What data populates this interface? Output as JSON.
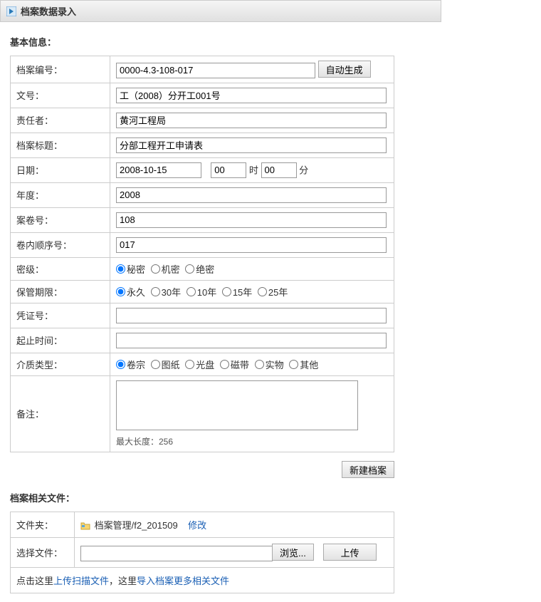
{
  "header": {
    "title": "档案数据录入"
  },
  "sections": {
    "basic_info": "基本信息：",
    "related_files": "档案相关文件："
  },
  "labels": {
    "archive_number": "档案编号：",
    "document_number": "文号：",
    "responsible": "责任者：",
    "archive_title": "档案标题：",
    "date": "日期：",
    "hour_suffix": "时",
    "minute_suffix": "分",
    "year": "年度：",
    "dossier_number": "案卷号：",
    "in_volume_seq": "卷内顺序号：",
    "secret_level": "密级：",
    "retention": "保管期限：",
    "voucher_number": "凭证号：",
    "start_end_time": "起止时间：",
    "media_type": "介质类型：",
    "remark": "备注：",
    "max_length": "最大长度：256"
  },
  "values": {
    "archive_number": "0000-4.3-108-017",
    "document_number": "工（2008）分开工001号",
    "responsible": "黄河工程局",
    "archive_title": "分部工程开工申请表",
    "date": "2008-10-15",
    "hour": "00",
    "minute": "00",
    "year": "2008",
    "dossier_number": "108",
    "in_volume_seq": "017",
    "voucher_number": "",
    "start_end_time": "",
    "remark": ""
  },
  "buttons": {
    "auto_generate": "自动生成",
    "new_archive": "新建档案",
    "browse": "浏览...",
    "upload": "上传",
    "modify": "修改"
  },
  "radios": {
    "secret": {
      "options": [
        "秘密",
        "机密",
        "绝密"
      ],
      "selected": 0
    },
    "retention": {
      "options": [
        "永久",
        "30年",
        "10年",
        "15年",
        "25年"
      ],
      "selected": 0
    },
    "media": {
      "options": [
        "卷宗",
        "图纸",
        "光盘",
        "磁带",
        "实物",
        "其他"
      ],
      "selected": 0
    }
  },
  "files": {
    "folder_label": "文件夹：",
    "folder_path": "档案管理/f2_201509",
    "select_file_label": "选择文件：",
    "hint_prefix": "点击这里",
    "hint_link1": "上传扫描文件",
    "hint_mid": "，这里",
    "hint_link2": "导入档案更多相关文件"
  }
}
